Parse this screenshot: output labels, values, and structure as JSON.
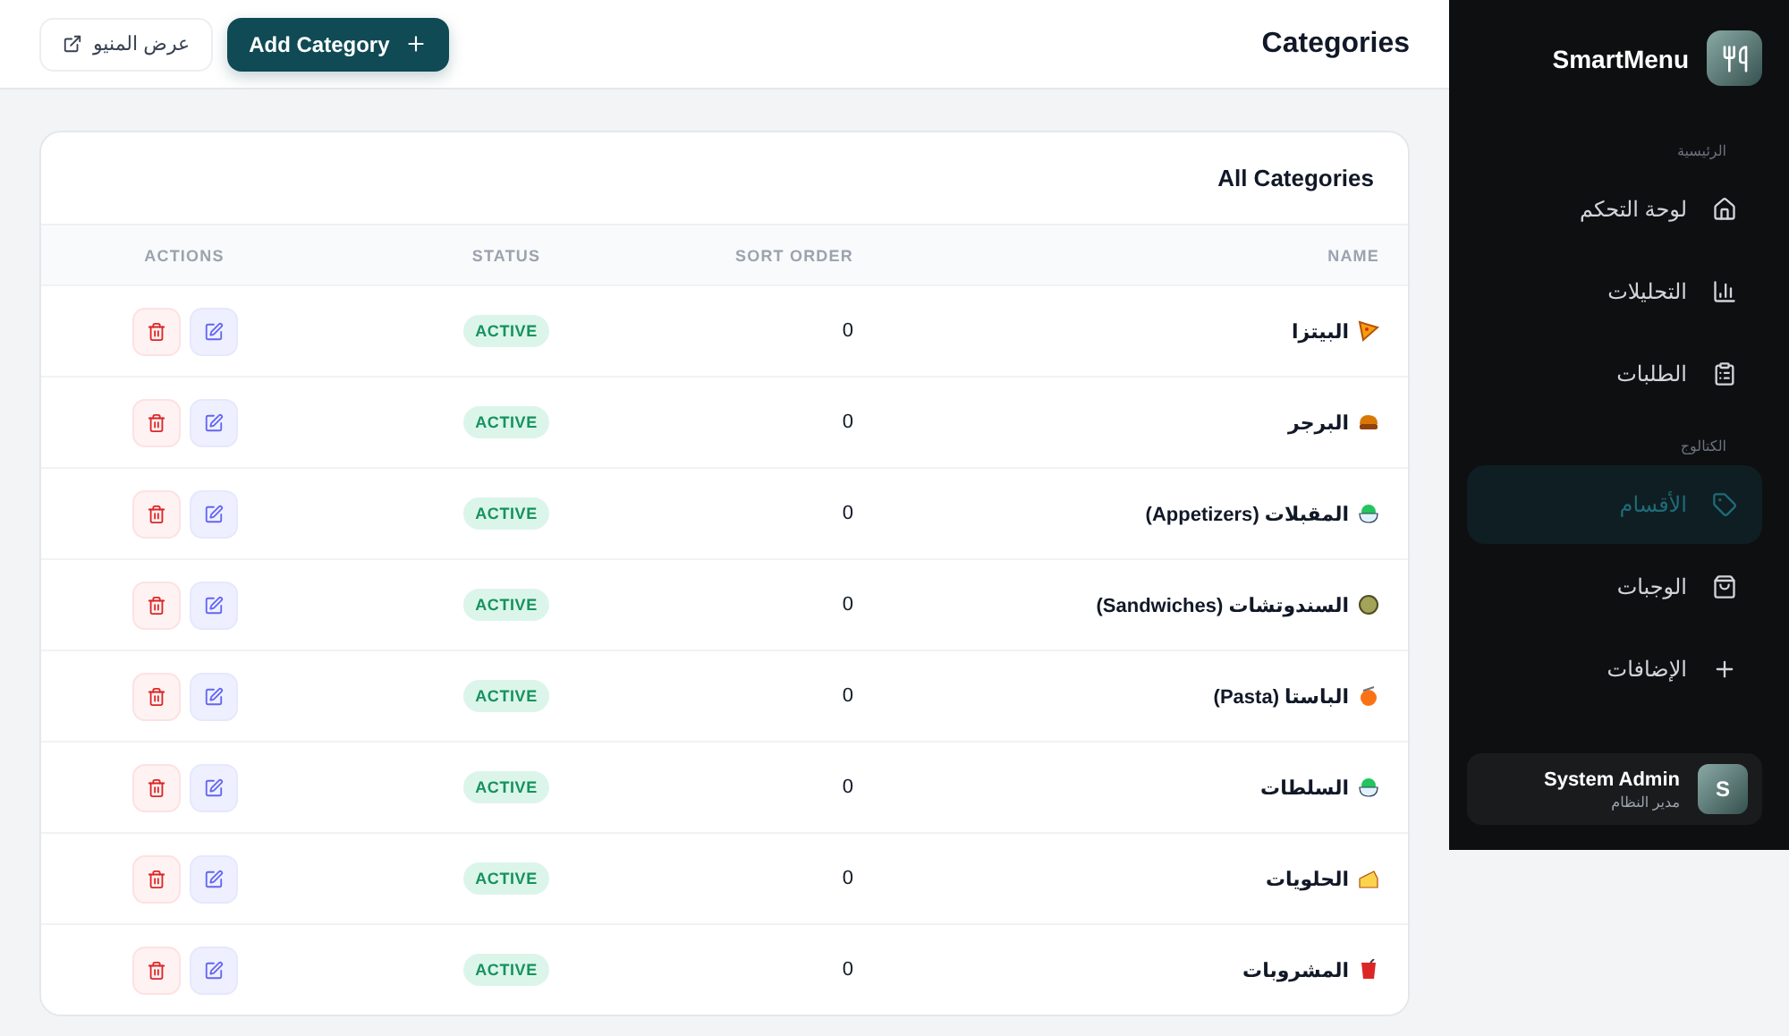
{
  "header": {
    "title": "Categories",
    "add_button": "Add Category",
    "view_menu_button": "عرض المنيو"
  },
  "card": {
    "title": "All Categories",
    "columns": [
      "NAME",
      "SORT ORDER",
      "STATUS",
      "ACTIONS"
    ],
    "rows": [
      {
        "name": "البيتزا",
        "kind": "pizza",
        "sort_order": "0",
        "status": "ACTIVE",
        "active": true
      },
      {
        "name": "البرجر",
        "kind": "burger",
        "sort_order": "0",
        "status": "ACTIVE",
        "active": true
      },
      {
        "name": "المقبلات (Appetizers)",
        "kind": "salad",
        "sort_order": "0",
        "status": "ACTIVE",
        "active": true
      },
      {
        "name": "السندوتشات (Sandwiches)",
        "kind": "wrap",
        "sort_order": "0",
        "status": "ACTIVE",
        "active": true
      },
      {
        "name": "الباستا (Pasta)",
        "kind": "pasta",
        "sort_order": "0",
        "status": "ACTIVE",
        "active": true
      },
      {
        "name": "السلطات",
        "kind": "salad",
        "sort_order": "0",
        "status": "ACTIVE",
        "active": true
      },
      {
        "name": "الحلويات",
        "kind": "cake",
        "sort_order": "0",
        "status": "ACTIVE",
        "active": true
      },
      {
        "name": "المشروبات",
        "kind": "drink",
        "sort_order": "0",
        "status": "ACTIVE",
        "active": true
      }
    ]
  },
  "sidebar": {
    "brand": "SmartMenu",
    "sections": [
      {
        "label": "الرئيسية",
        "items": [
          {
            "label": "لوحة التحكم",
            "kind": "home",
            "selected": false
          },
          {
            "label": "التحليلات",
            "kind": "chart",
            "selected": false
          },
          {
            "label": "الطلبات",
            "kind": "clipboard",
            "selected": false
          }
        ]
      },
      {
        "label": "الكتالوج",
        "items": [
          {
            "label": "الأقسام",
            "kind": "tag",
            "selected": true
          },
          {
            "label": "الوجبات",
            "kind": "bag",
            "selected": false
          },
          {
            "label": "الإضافات",
            "kind": "plus",
            "selected": false
          }
        ]
      }
    ],
    "user": {
      "initial": "S",
      "name": "System Admin",
      "role": "مدير النظام"
    }
  }
}
